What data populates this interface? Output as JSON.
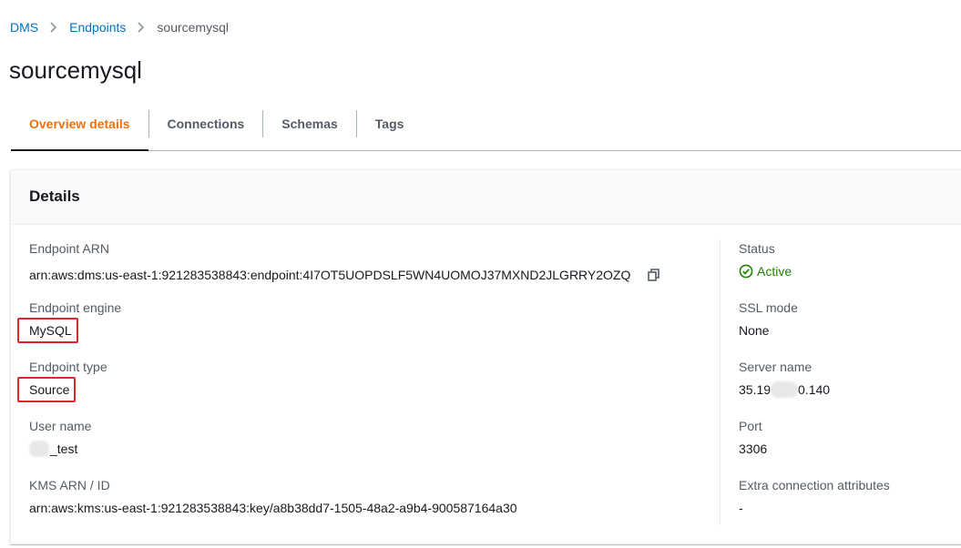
{
  "breadcrumb": {
    "items": [
      {
        "label": "DMS"
      },
      {
        "label": "Endpoints"
      }
    ],
    "current": "sourcemysql"
  },
  "page": {
    "title": "sourcemysql"
  },
  "tabs": [
    {
      "label": "Overview details",
      "active": true
    },
    {
      "label": "Connections",
      "active": false
    },
    {
      "label": "Schemas",
      "active": false
    },
    {
      "label": "Tags",
      "active": false
    }
  ],
  "details": {
    "title": "Details",
    "left": {
      "endpoint_arn": {
        "label": "Endpoint ARN",
        "value": "arn:aws:dms:us-east-1:921283538843:endpoint:4I7OT5UOPDSLF5WN4UOMOJ37MXND2JLGRRY2OZQ"
      },
      "endpoint_engine": {
        "label": "Endpoint engine",
        "value": "MySQL"
      },
      "endpoint_type": {
        "label": "Endpoint type",
        "value": "Source"
      },
      "user_name": {
        "label": "User name",
        "value": "_test"
      },
      "kms_arn": {
        "label": "KMS ARN / ID",
        "value": "arn:aws:kms:us-east-1:921283538843:key/a8b38dd7-1505-48a2-a9b4-900587164a30"
      }
    },
    "right": {
      "status": {
        "label": "Status",
        "value": "Active"
      },
      "ssl_mode": {
        "label": "SSL mode",
        "value": "None"
      },
      "server_name": {
        "label": "Server name",
        "value_prefix": "35.19",
        "value_suffix": "0.140"
      },
      "port": {
        "label": "Port",
        "value": "3306"
      },
      "extra_connection_attributes": {
        "label": "Extra connection attributes",
        "value": "-"
      }
    }
  },
  "colors": {
    "link": "#0073bb",
    "active_tab": "#ec7211",
    "status_ok": "#1d8102",
    "highlight": "#e0262b"
  },
  "icons": {
    "breadcrumb_separator": "chevron-right-icon",
    "copy": "copy-icon",
    "status": "check-circle-icon"
  }
}
